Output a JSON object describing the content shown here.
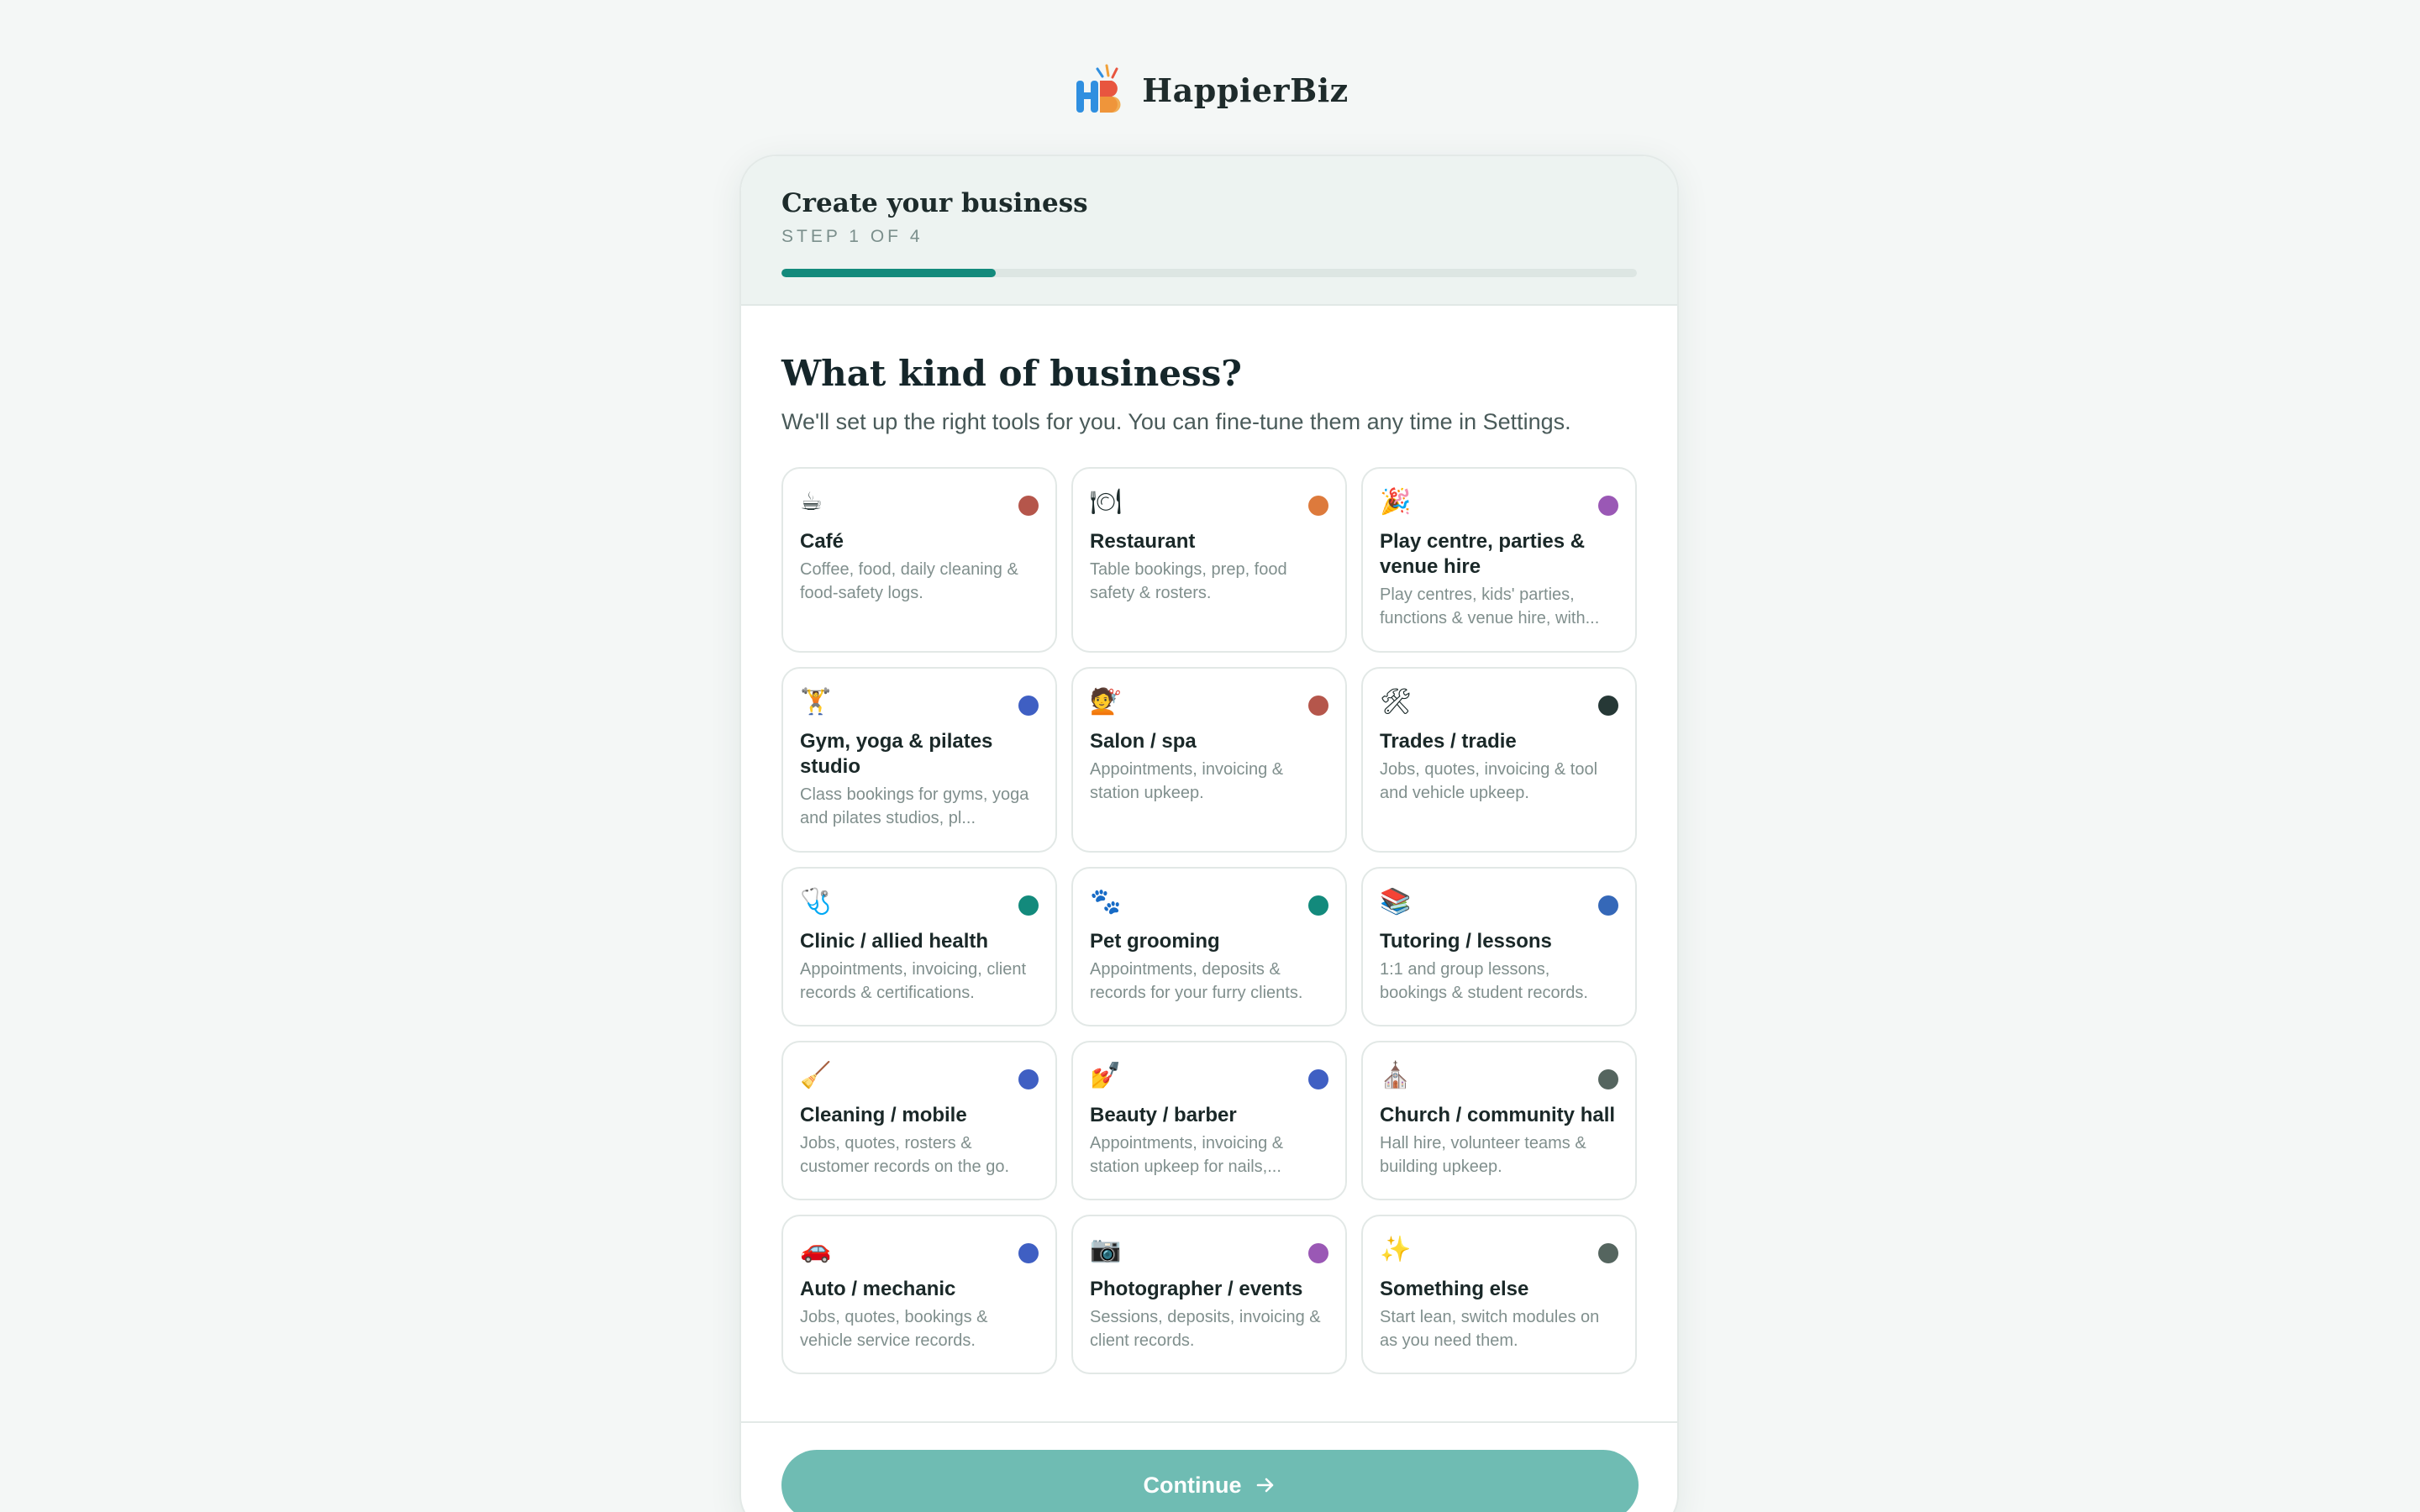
{
  "brand": {
    "name": "HappierBiz",
    "logo_icon": "hb-logo-icon"
  },
  "header": {
    "title": "Create your business",
    "step": "STEP 1 OF 4",
    "progress_fraction": 0.25,
    "accent": "#138a7c"
  },
  "main": {
    "question": "What kind of business?",
    "subtitle": "We'll set up the right tools for you. You can fine-tune them any time in Settings.",
    "options": [
      {
        "icon": "coffee-icon",
        "glyph": "☕",
        "title": "Café",
        "desc": "Coffee, food, daily cleaning & food-safety logs.",
        "dot": "#b5564b"
      },
      {
        "icon": "plate-cutlery-icon",
        "glyph": "🍽",
        "title": "Restaurant",
        "desc": "Table bookings, prep, food safety & rosters.",
        "dot": "#dd7a3c"
      },
      {
        "icon": "party-popper-icon",
        "glyph": "🎉",
        "title": "Play centre, parties & venue hire",
        "desc": "Play centres, kids' parties, functions & venue hire, with...",
        "dot": "#9a58b5"
      },
      {
        "icon": "weightlifter-icon",
        "glyph": "🏋",
        "title": "Gym, yoga & pilates studio",
        "desc": "Class bookings for gyms, yoga and pilates studios, pl...",
        "dot": "#3f5fc3"
      },
      {
        "icon": "hairdresser-icon",
        "glyph": "💇",
        "title": "Salon / spa",
        "desc": "Appointments, invoicing & station upkeep.",
        "dot": "#b5564b"
      },
      {
        "icon": "tools-icon",
        "glyph": "🛠",
        "title": "Trades / tradie",
        "desc": "Jobs, quotes, invoicing & tool and vehicle upkeep.",
        "dot": "#263836"
      },
      {
        "icon": "stethoscope-icon",
        "glyph": "🩺",
        "title": "Clinic / allied health",
        "desc": "Appointments, invoicing, client records & certifications.",
        "dot": "#138a7c"
      },
      {
        "icon": "paw-prints-icon",
        "glyph": "🐾",
        "title": "Pet grooming",
        "desc": "Appointments, deposits & records for your furry clients.",
        "dot": "#138a7c"
      },
      {
        "icon": "books-icon",
        "glyph": "📚",
        "title": "Tutoring / lessons",
        "desc": "1:1 and group lessons, bookings & student records.",
        "dot": "#3568b8"
      },
      {
        "icon": "broom-icon",
        "glyph": "🧹",
        "title": "Cleaning / mobile",
        "desc": "Jobs, quotes, rosters & customer records on the go.",
        "dot": "#3f5fc3"
      },
      {
        "icon": "nail-polish-icon",
        "glyph": "💅",
        "title": "Beauty / barber",
        "desc": "Appointments, invoicing & station upkeep for nails,...",
        "dot": "#3f5fc3"
      },
      {
        "icon": "church-icon",
        "glyph": "⛪",
        "title": "Church / community hall",
        "desc": "Hall hire, volunteer teams & building upkeep.",
        "dot": "#55655f"
      },
      {
        "icon": "car-icon",
        "glyph": "🚗",
        "title": "Auto / mechanic",
        "desc": "Jobs, quotes, bookings & vehicle service records.",
        "dot": "#3f5fc3"
      },
      {
        "icon": "camera-icon",
        "glyph": "📷",
        "title": "Photographer / events",
        "desc": "Sessions, deposits, invoicing & client records.",
        "dot": "#9a58b5"
      },
      {
        "icon": "sparkles-icon",
        "glyph": "✨",
        "title": "Something else",
        "desc": "Start lean, switch modules on as you need them.",
        "dot": "#55655f"
      }
    ]
  },
  "footer": {
    "continue_label": "Continue",
    "arrow_icon": "arrow-right-icon",
    "button_color": "#6fbcb3"
  }
}
